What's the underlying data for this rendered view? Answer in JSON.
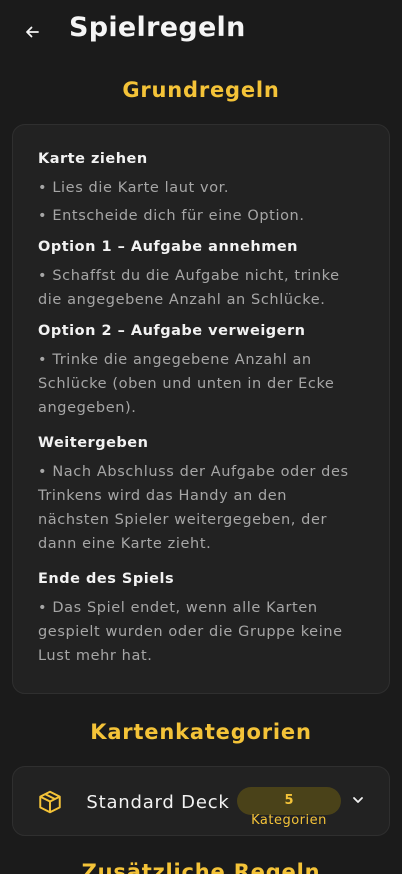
{
  "header": {
    "title": "Spielregeln",
    "back_icon": "arrow-left-icon"
  },
  "basic_rules": {
    "title": "Grundregeln",
    "sections": [
      {
        "heading": "Karte ziehen",
        "lines": [
          "• Lies die Karte laut vor.",
          "• Entscheide dich für eine Option."
        ]
      },
      {
        "heading": "Option 1 – Aufgabe annehmen",
        "lines": [
          "• Schaffst du die Aufgabe nicht, trinke die angegebene Anzahl an Schlücke."
        ]
      },
      {
        "heading": "Option 2 – Aufgabe verweigern",
        "lines": [
          "• Trinke die angegebene Anzahl an Schlücke (oben und unten in der Ecke angegeben)."
        ]
      },
      {
        "heading": "Weitergeben",
        "lines": [
          "• Nach Abschluss der Aufgabe oder des Trinkens wird das Handy an den nächsten Spieler weitergegeben, der dann eine Karte zieht."
        ]
      },
      {
        "heading": "Ende des Spiels",
        "lines": [
          "• Das Spiel endet, wenn alle Karten gespielt wurden oder die Gruppe keine Lust mehr hat."
        ]
      }
    ]
  },
  "categories": {
    "title": "Kartenkategorien",
    "deck": {
      "name": "Standard Deck",
      "icon": "package-icon",
      "count": "5",
      "count_label": "Kategorien",
      "expand_icon": "chevron-down-icon"
    }
  },
  "extra_rules": {
    "title": "Zusätzliche Regeln"
  },
  "colors": {
    "background": "#1b1b1b",
    "card": "#222222",
    "accent": "#f4c338",
    "text_primary": "#f2f2f2",
    "text_secondary": "#a6a6a6"
  }
}
